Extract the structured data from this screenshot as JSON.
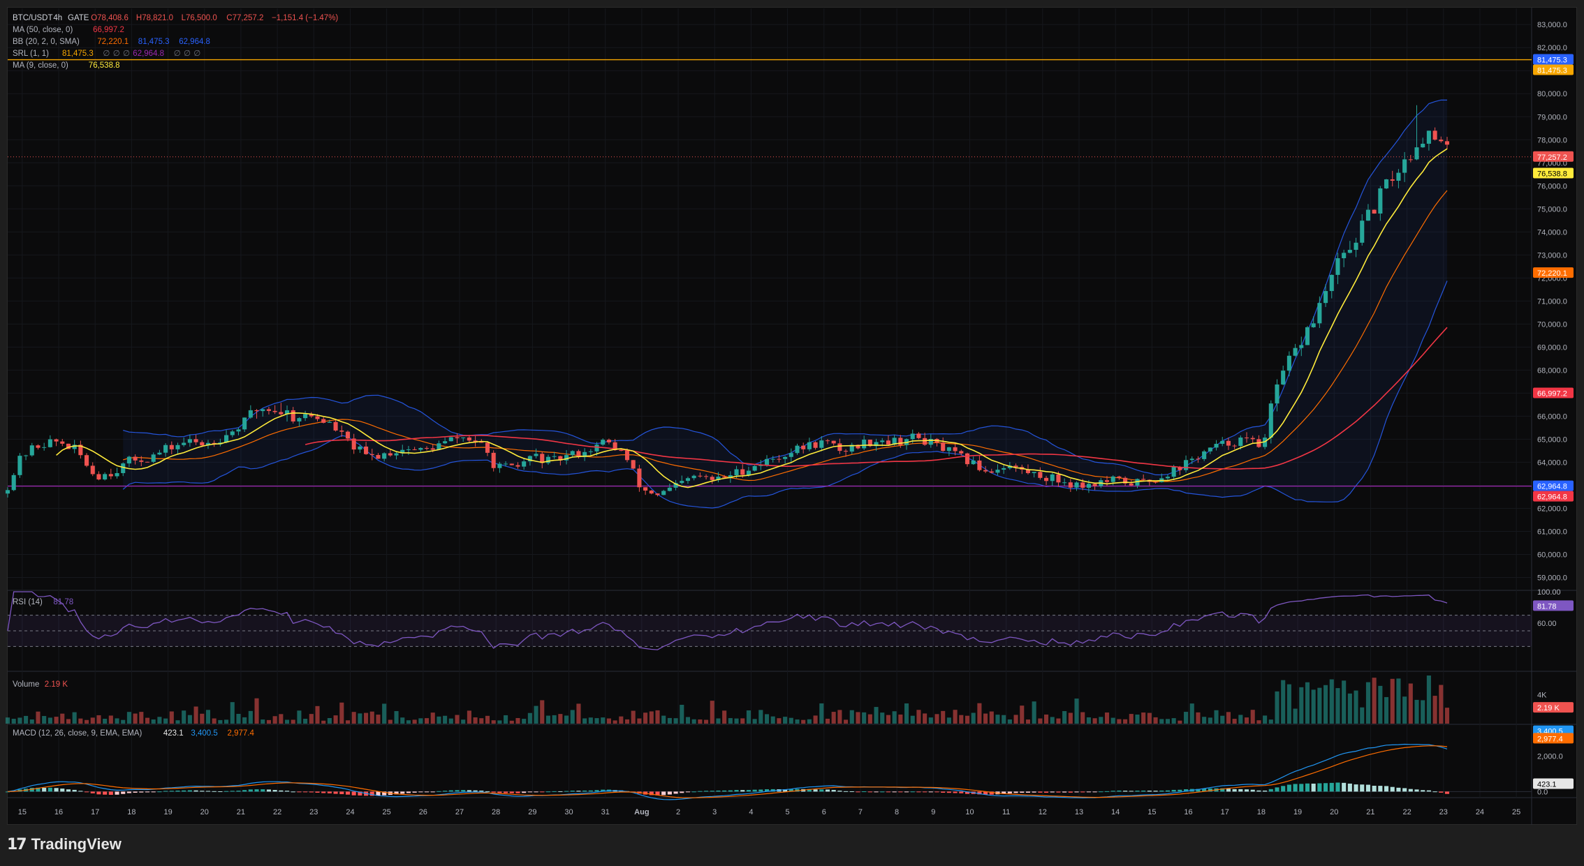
{
  "app": {
    "brand": "TradingView",
    "brand_mark": "17"
  },
  "colors": {
    "up": "#26a69a",
    "down": "#ef5350",
    "ma50": "#f23645",
    "ma9": "#ffeb3b",
    "bb_basis": "#ff6d00",
    "bb_band": "#2962ff",
    "srl": "#f7a600",
    "support": "#9c27b0",
    "rsi": "#7e57c2",
    "macd": "#2196f3",
    "signal": "#ff6d00",
    "text": "#b2b5be"
  },
  "legend": {
    "main": {
      "symbol": "BTC/USDT",
      "interval": "4h",
      "exchange": "GATE",
      "open": "O78,408.6",
      "high": "H78,821.0",
      "low": "L76,500.0",
      "close": "C77,257.2",
      "change": "−1,151.4 (−1.47%)"
    },
    "ma50": {
      "label": "MA (50, close, 0)",
      "value": "66,997.2"
    },
    "bb": {
      "label": "BB (20, 2, 0, SMA)",
      "basis": "72,220.1",
      "upper": "81,475.3",
      "lower": "62,964.8"
    },
    "srl": {
      "label": "SRL (1, 1)",
      "v1": "81,475.3",
      "v2": "∅",
      "v3": "∅",
      "v4": "∅",
      "v5": "62,964.8",
      "v6": "∅",
      "v7": "∅",
      "v8": "∅"
    },
    "ma9": {
      "label": "MA (9, close, 0)",
      "value": "76,538.8"
    },
    "rsi": {
      "label": "RSI (14)",
      "value": "81.78"
    },
    "volume": {
      "label": "Volume",
      "value": "2.19 K"
    },
    "macd": {
      "label": "MACD (12, 26, close, 9, EMA, EMA)",
      "hist": "423.1",
      "macd": "3,400.5",
      "signal": "2,977.4"
    }
  },
  "price_axis": {
    "ticks": [
      "83,000.0",
      "82,000.0",
      "81,000.0",
      "80,000.0",
      "79,000.0",
      "78,000.0",
      "77,000.0",
      "76,000.0",
      "75,000.0",
      "74,000.0",
      "73,000.0",
      "72,000.0",
      "71,000.0",
      "70,000.0",
      "69,000.0",
      "68,000.0",
      "67,000.0",
      "66,000.0",
      "65,000.0",
      "64,000.0",
      "63,000.0",
      "62,000.0",
      "61,000.0",
      "60,000.0",
      "59,000.0"
    ],
    "tick_values": [
      83000,
      82000,
      81000,
      80000,
      79000,
      78000,
      77000,
      76000,
      75000,
      74000,
      73000,
      72000,
      71000,
      70000,
      69000,
      68000,
      67000,
      66000,
      65000,
      64000,
      63000,
      62000,
      61000,
      60000,
      59000
    ],
    "range": [
      58500,
      83400
    ],
    "badges": [
      {
        "text": "81,475.3",
        "value": 81475.3,
        "color": "#2962ff"
      },
      {
        "text": "81,475.3",
        "value": 81475.3,
        "color": "#f7a600",
        "stack": 1
      },
      {
        "text": "77,257.2",
        "value": 77257.2,
        "color": "#ef5350"
      },
      {
        "text": "76,538.8",
        "value": 76538.8,
        "color": "#ffeb3b",
        "dark_text": true
      },
      {
        "text": "72,220.1",
        "value": 72220.1,
        "color": "#ff6d00"
      },
      {
        "text": "66,997.2",
        "value": 66997.2,
        "color": "#f23645"
      },
      {
        "text": "62,964.8",
        "value": 62964.8,
        "color": "#2962ff"
      },
      {
        "text": "62,964.8",
        "value": 62964.8,
        "color": "#f23645",
        "stack": 1
      }
    ]
  },
  "rsi_axis": {
    "ticks": [
      "100.00",
      "60.00"
    ],
    "tick_values": [
      100,
      60
    ],
    "range": [
      0,
      100
    ],
    "badge": "81.78",
    "upper": 70,
    "mid": 50,
    "lower": 30
  },
  "volume_axis": {
    "tick": "4K",
    "tick_value": 4000,
    "max": 7000,
    "badge": "2.19 K"
  },
  "macd_axis": {
    "ticks": [
      "2,000.0",
      "0.0"
    ],
    "tick_values": [
      2000,
      0
    ],
    "range": [
      -300,
      3700
    ],
    "badges": [
      {
        "text": "3,400.5",
        "value": 3400.5,
        "color": "#2196f3"
      },
      {
        "text": "2,977.4",
        "value": 2977.4,
        "color": "#ff6d00"
      },
      {
        "text": "423.1",
        "value": 423.1,
        "color": "#e6e6e6",
        "dark_text": true
      }
    ]
  },
  "time_axis": {
    "labels": [
      "15",
      "16",
      "17",
      "18",
      "19",
      "20",
      "21",
      "22",
      "23",
      "24",
      "25",
      "26",
      "27",
      "28",
      "29",
      "30",
      "31",
      "Aug",
      "2",
      "3",
      "4",
      "5",
      "6",
      "7",
      "8",
      "9",
      "10",
      "11",
      "12",
      "13",
      "14",
      "15",
      "16",
      "17",
      "18",
      "19",
      "20",
      "21",
      "22",
      "23",
      "24",
      "25"
    ],
    "start_day": 14.6,
    "end_day": 56.4
  },
  "chart_data": {
    "type": "candlestick",
    "symbol": "BTC/USDT",
    "interval": "4h",
    "last": {
      "open": 78408.6,
      "high": 78821.0,
      "low": 76500.0,
      "close": 77257.2
    },
    "daily_closes": [
      [
        14.6,
        63000
      ],
      [
        15,
        64300
      ],
      [
        15.5,
        64800
      ],
      [
        16,
        64900
      ],
      [
        16.5,
        64500
      ],
      [
        17,
        63400
      ],
      [
        17.5,
        63600
      ],
      [
        18,
        64100
      ],
      [
        18.5,
        64200
      ],
      [
        19,
        64600
      ],
      [
        19.5,
        64900
      ],
      [
        20,
        64800
      ],
      [
        20.5,
        65100
      ],
      [
        21,
        65600
      ],
      [
        21.5,
        66400
      ],
      [
        22,
        66300
      ],
      [
        22.5,
        66000
      ],
      [
        23,
        66000
      ],
      [
        23.5,
        65600
      ],
      [
        24,
        64800
      ],
      [
        24.5,
        64200
      ],
      [
        25,
        64400
      ],
      [
        25.5,
        64600
      ],
      [
        26,
        64500
      ],
      [
        26.5,
        64800
      ],
      [
        27,
        65100
      ],
      [
        27.5,
        64900
      ],
      [
        28,
        63800
      ],
      [
        28.5,
        63700
      ],
      [
        29,
        64300
      ],
      [
        29.5,
        64000
      ],
      [
        30,
        64300
      ],
      [
        30.5,
        64500
      ],
      [
        31,
        64900
      ],
      [
        31.5,
        64400
      ],
      [
        32,
        62800
      ],
      [
        32.5,
        62600
      ],
      [
        33,
        63000
      ],
      [
        33.5,
        63400
      ],
      [
        34,
        63200
      ],
      [
        34.5,
        63500
      ],
      [
        35,
        63800
      ],
      [
        35.5,
        64100
      ],
      [
        36,
        64400
      ],
      [
        36.5,
        64700
      ],
      [
        37,
        64900
      ],
      [
        37.5,
        64500
      ],
      [
        38,
        64800
      ],
      [
        38.5,
        65000
      ],
      [
        39,
        64900
      ],
      [
        39.5,
        65100
      ],
      [
        40,
        64800
      ],
      [
        40.5,
        64400
      ],
      [
        41,
        64000
      ],
      [
        41.5,
        63600
      ],
      [
        42,
        63900
      ],
      [
        42.5,
        63600
      ],
      [
        43,
        63400
      ],
      [
        43.5,
        63200
      ],
      [
        44,
        63000
      ],
      [
        44.5,
        63100
      ],
      [
        45,
        63200
      ],
      [
        45.5,
        63100
      ],
      [
        46,
        63200
      ],
      [
        46.5,
        63600
      ],
      [
        47,
        64000
      ],
      [
        47.5,
        64500
      ],
      [
        48,
        64800
      ],
      [
        48.5,
        65000
      ],
      [
        49,
        64700
      ],
      [
        49.5,
        67500
      ],
      [
        50,
        69000
      ],
      [
        50.5,
        70400
      ],
      [
        51,
        72300
      ],
      [
        51.5,
        73500
      ],
      [
        52,
        74800
      ],
      [
        52.5,
        76200
      ],
      [
        53,
        77200
      ],
      [
        53.5,
        78300
      ],
      [
        54,
        77700
      ],
      [
        54.2,
        77257.2
      ]
    ],
    "overlays": {
      "ma9_value": 76538.8,
      "ma50_value": 66997.2,
      "bb_basis": 72220.1,
      "bb_upper": 81475.3,
      "bb_lower": 62964.8
    },
    "levels": {
      "resistance": 81475.3,
      "support": 62964.8,
      "last_price": 77257.2
    },
    "rsi_last": 81.78,
    "volume_last": 2190,
    "macd_last": {
      "macd": 3400.5,
      "signal": 2977.4,
      "hist": 423.1
    }
  }
}
